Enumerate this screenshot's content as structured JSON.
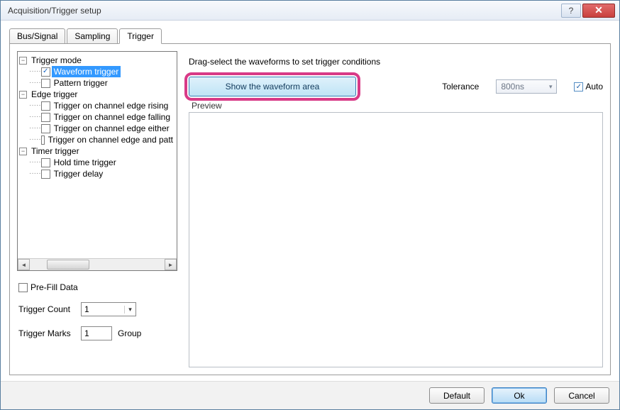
{
  "window": {
    "title": "Acquisition/Trigger setup"
  },
  "tabs": {
    "bus": "Bus/Signal",
    "sampling": "Sampling",
    "trigger": "Trigger"
  },
  "tree": {
    "trigger_mode": {
      "label": "Trigger mode",
      "waveform": "Waveform trigger",
      "pattern": "Pattern trigger"
    },
    "edge_trigger": {
      "label": "Edge trigger",
      "rising": "Trigger on channel edge rising",
      "falling": "Trigger on channel edge falling",
      "either": "Trigger on channel edge either",
      "andpatt": "Trigger on channel edge and patt"
    },
    "timer_trigger": {
      "label": "Timer trigger",
      "hold": "Hold time trigger",
      "delay": "Trigger delay"
    }
  },
  "left_panel": {
    "prefill": "Pre-Fill Data",
    "trigger_count_label": "Trigger Count",
    "trigger_count_value": "1",
    "trigger_marks_label": "Trigger Marks",
    "trigger_marks_value": "1",
    "group": "Group"
  },
  "right_panel": {
    "instruction": "Drag-select the waveforms to set trigger conditions",
    "show_btn": "Show the waveform area",
    "tolerance_label": "Tolerance",
    "tolerance_value": "800ns",
    "auto": "Auto",
    "preview": "Preview"
  },
  "bottom": {
    "default": "Default",
    "ok": "Ok",
    "cancel": "Cancel"
  },
  "glyph": {
    "minus": "−",
    "check": "✓",
    "left": "◄",
    "right": "►",
    "down": "▾"
  }
}
